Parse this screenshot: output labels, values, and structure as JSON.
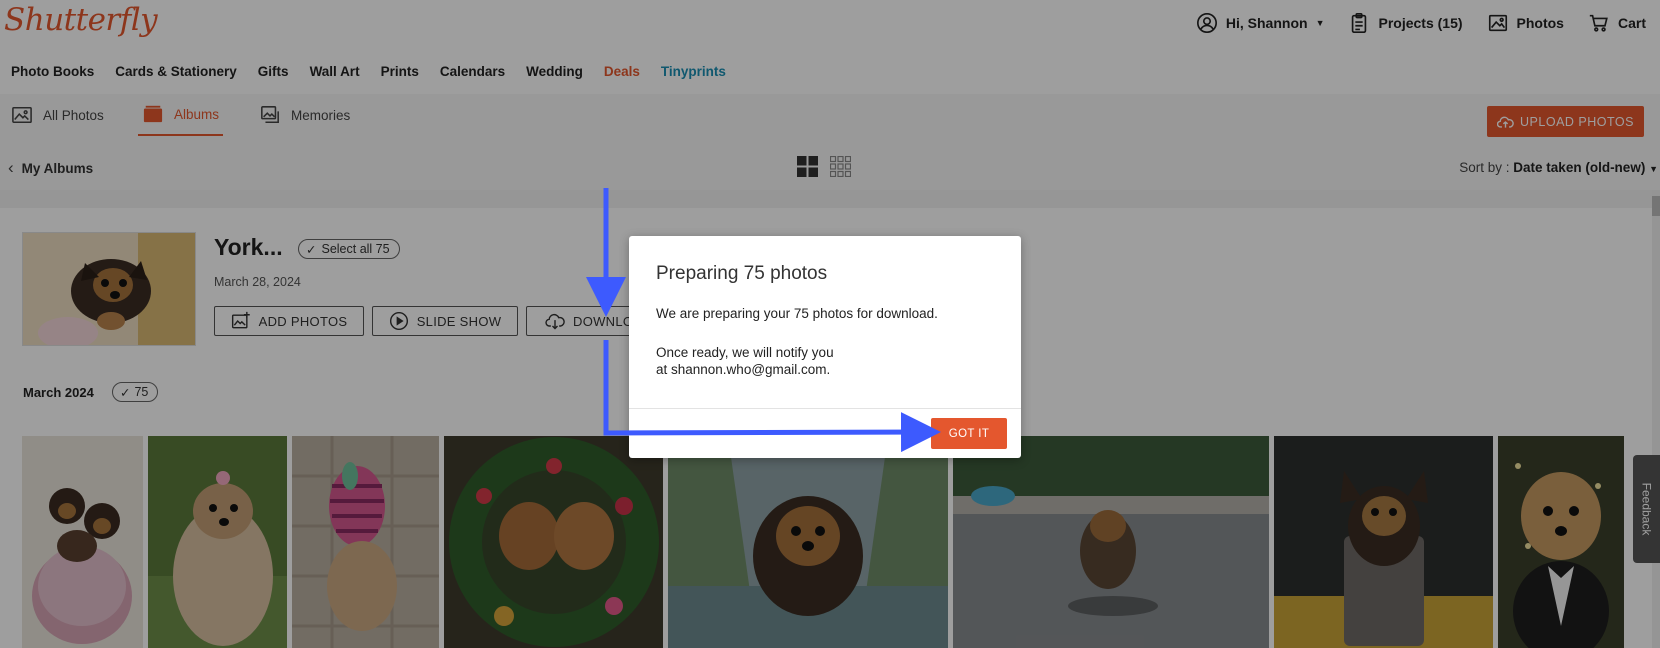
{
  "brand": {
    "logo_text": "Shutterfly",
    "accent": "#e4572e",
    "teal": "#1a8fb3"
  },
  "account": {
    "greeting": "Hi, Shannon",
    "projects_label": "Projects (15)",
    "photos_label": "Photos",
    "cart_label": "Cart"
  },
  "category_nav": [
    {
      "label": "Photo Books"
    },
    {
      "label": "Cards & Stationery"
    },
    {
      "label": "Gifts"
    },
    {
      "label": "Wall Art"
    },
    {
      "label": "Prints"
    },
    {
      "label": "Calendars"
    },
    {
      "label": "Wedding"
    },
    {
      "label": "Deals"
    },
    {
      "label": "Tinyprints"
    }
  ],
  "tabs": {
    "all_photos": "All Photos",
    "albums": "Albums",
    "memories": "Memories"
  },
  "upload_button": "UPLOAD PHOTOS",
  "album_bar": {
    "back_label": "My Albums",
    "sort_prefix": "Sort by :",
    "sort_value": "Date taken (old-new)"
  },
  "album": {
    "title": "York...",
    "select_all": "Select all 75",
    "date": "March 28, 2024",
    "add_photos": "ADD PHOTOS",
    "slide_show": "SLIDE SHOW",
    "download": "DOWNLO"
  },
  "month_group": {
    "label": "March 2024",
    "count": "75"
  },
  "feedback_label": "Feedback",
  "modal": {
    "title": "Preparing 75 photos",
    "message": "We are preparing your 75 photos for download.",
    "note_line1": "Once ready, we will notify you",
    "note_line2": "at shannon.who@gmail.com.",
    "button": "GOT IT"
  },
  "annotation_color": "#3d5afe"
}
